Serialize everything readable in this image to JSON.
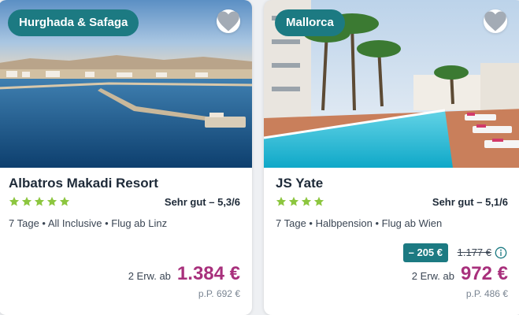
{
  "colors": {
    "badge_bg": "#1c7a82",
    "price": "#a8307c",
    "star": "#8cc63f",
    "text": "#1e2a38"
  },
  "hotels": [
    {
      "region": "Hurghada & Safaga",
      "name": "Albatros Makadi Resort",
      "stars": 5,
      "rating": "Sehr gut – 5,3/6",
      "details": "7 Tage • All Inclusive • Flug ab Linz",
      "persons": "2 Erw. ab",
      "price": "1.384 €",
      "per_person": "p.P. 692 €",
      "favorite_icon": "heart-icon"
    },
    {
      "region": "Mallorca",
      "name": "JS Yate",
      "stars": 4,
      "rating": "Sehr gut – 5,1/6",
      "details": "7 Tage • Halbpension • Flug ab Wien",
      "discount": "– 205 €",
      "old_price": "1.177 €",
      "persons": "2 Erw. ab",
      "price": "972 €",
      "per_person": "p.P. 486 €",
      "favorite_icon": "heart-icon",
      "info_icon": "info-icon"
    }
  ]
}
